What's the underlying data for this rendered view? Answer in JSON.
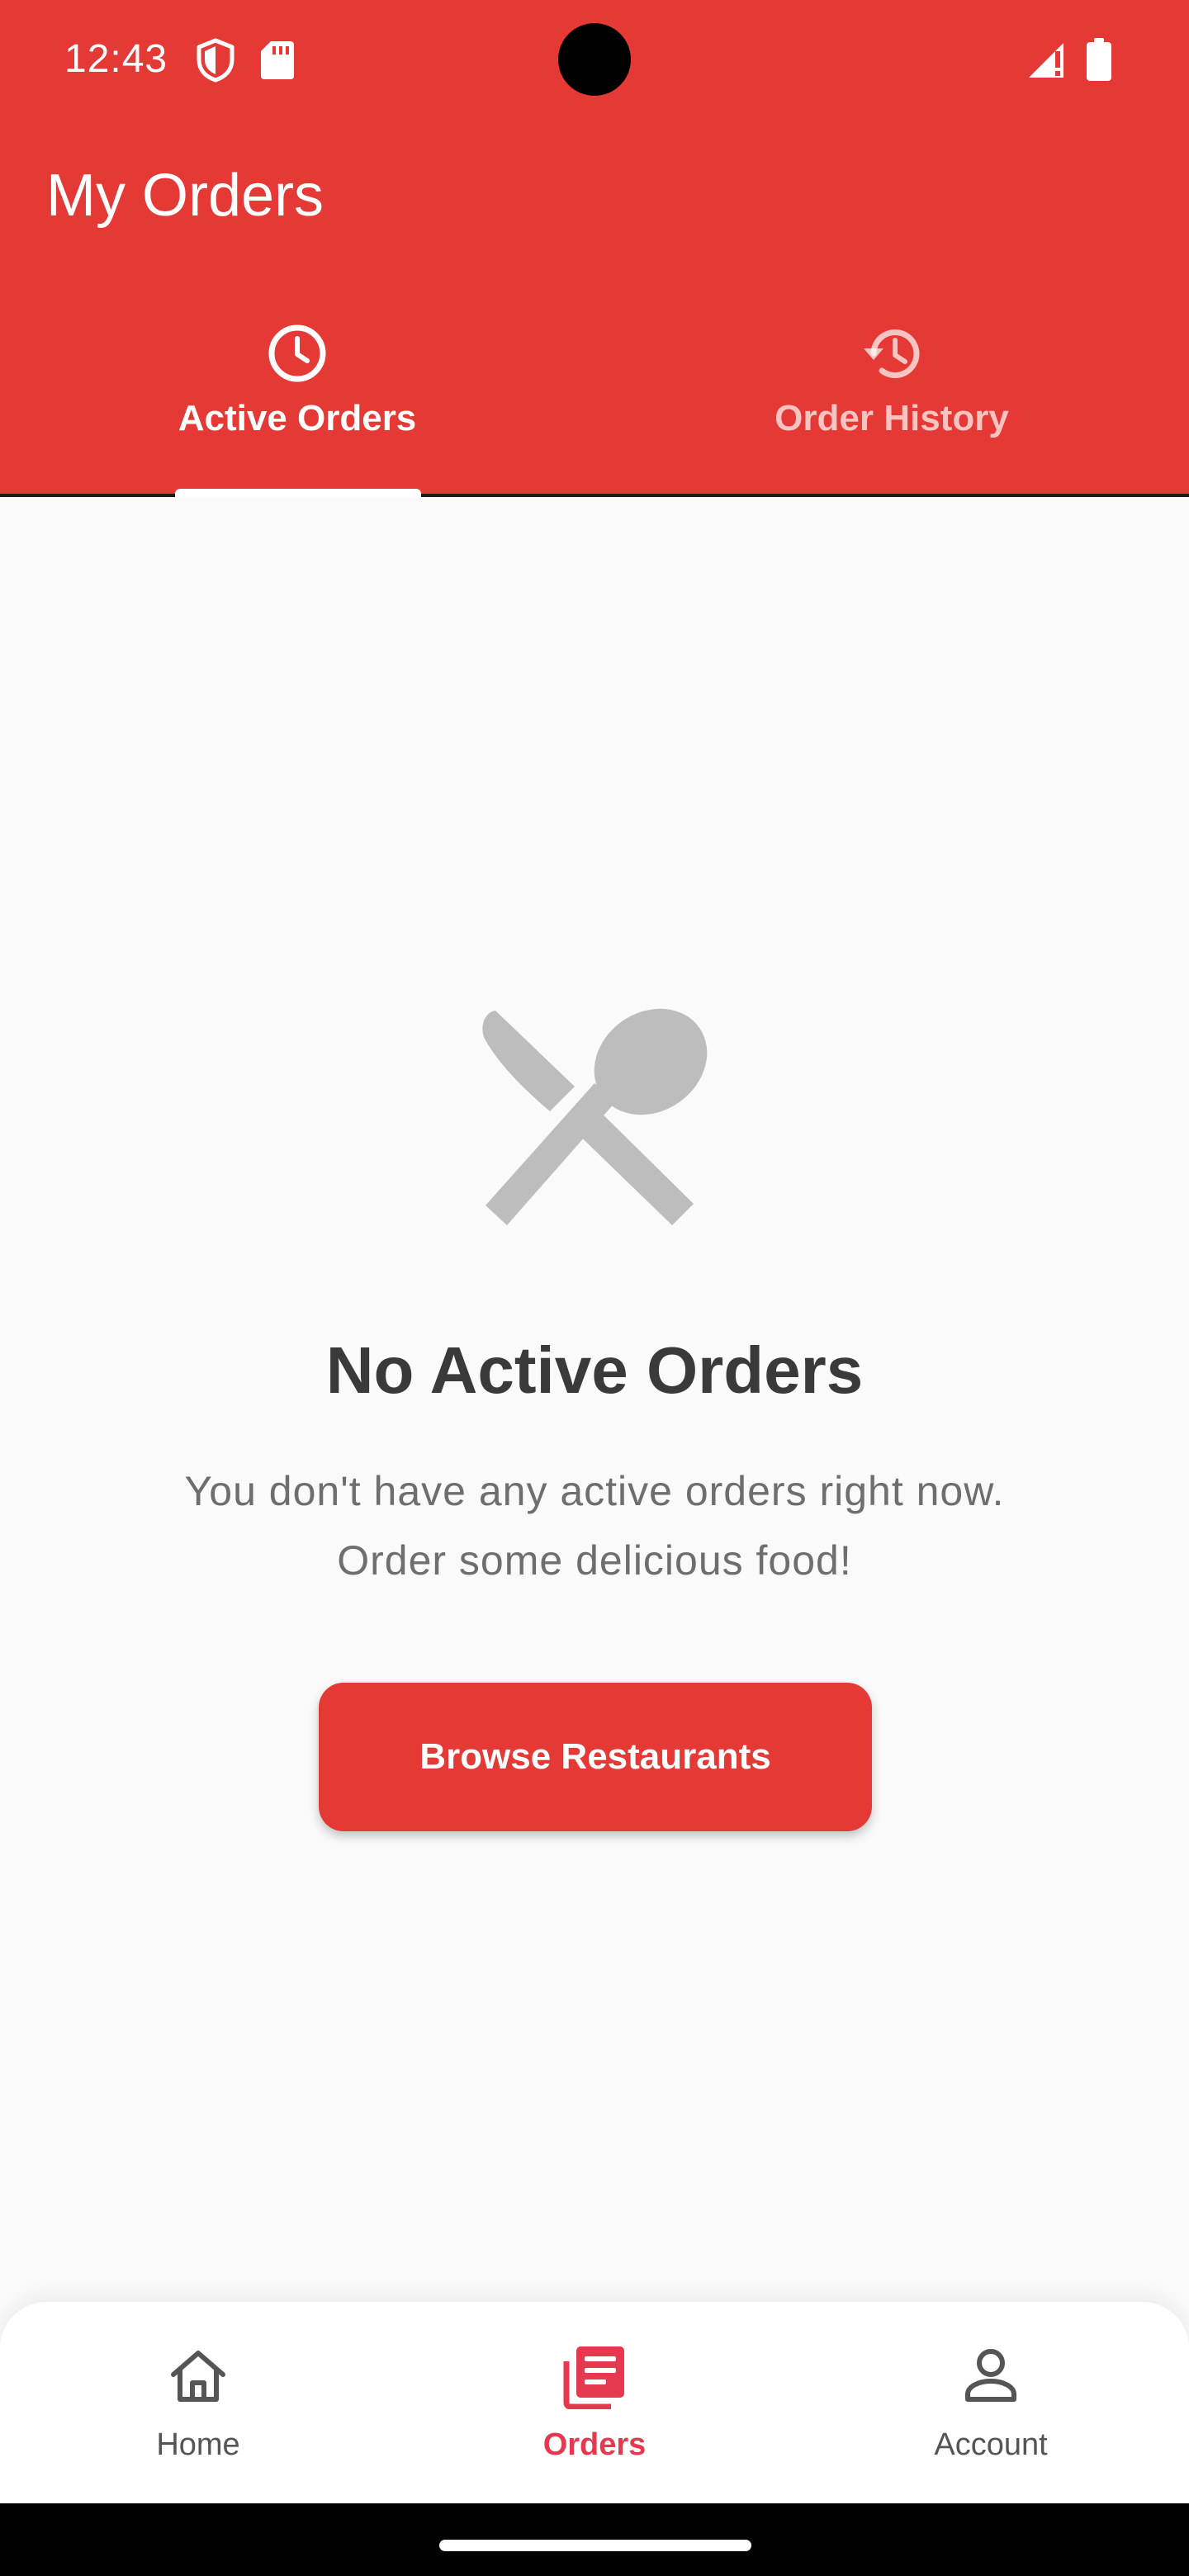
{
  "status_bar": {
    "time": "12:43",
    "icons": [
      "shield-icon",
      "sd-card-icon",
      "signal-icon",
      "battery-icon"
    ]
  },
  "header": {
    "title": "My Orders",
    "tabs": [
      {
        "label": "Active Orders",
        "icon": "clock-icon",
        "selected": true
      },
      {
        "label": "Order History",
        "icon": "history-icon",
        "selected": false
      }
    ]
  },
  "empty_state": {
    "icon": "utensils-icon",
    "title": "No Active Orders",
    "message_line1": "You don't have any active orders right now.",
    "message_line2": "Order some delicious food!",
    "button_label": "Browse Restaurants"
  },
  "bottom_nav": {
    "items": [
      {
        "label": "Home",
        "icon": "home-icon",
        "selected": false
      },
      {
        "label": "Orders",
        "icon": "orders-icon",
        "selected": true
      },
      {
        "label": "Account",
        "icon": "person-icon",
        "selected": false
      }
    ]
  },
  "colors": {
    "primary": "#e53935",
    "nav_selected": "#e53950",
    "background": "#fafafa",
    "empty_icon": "#bdbdbd",
    "empty_title": "#3a3a3a",
    "empty_message": "#6e6e6e"
  }
}
